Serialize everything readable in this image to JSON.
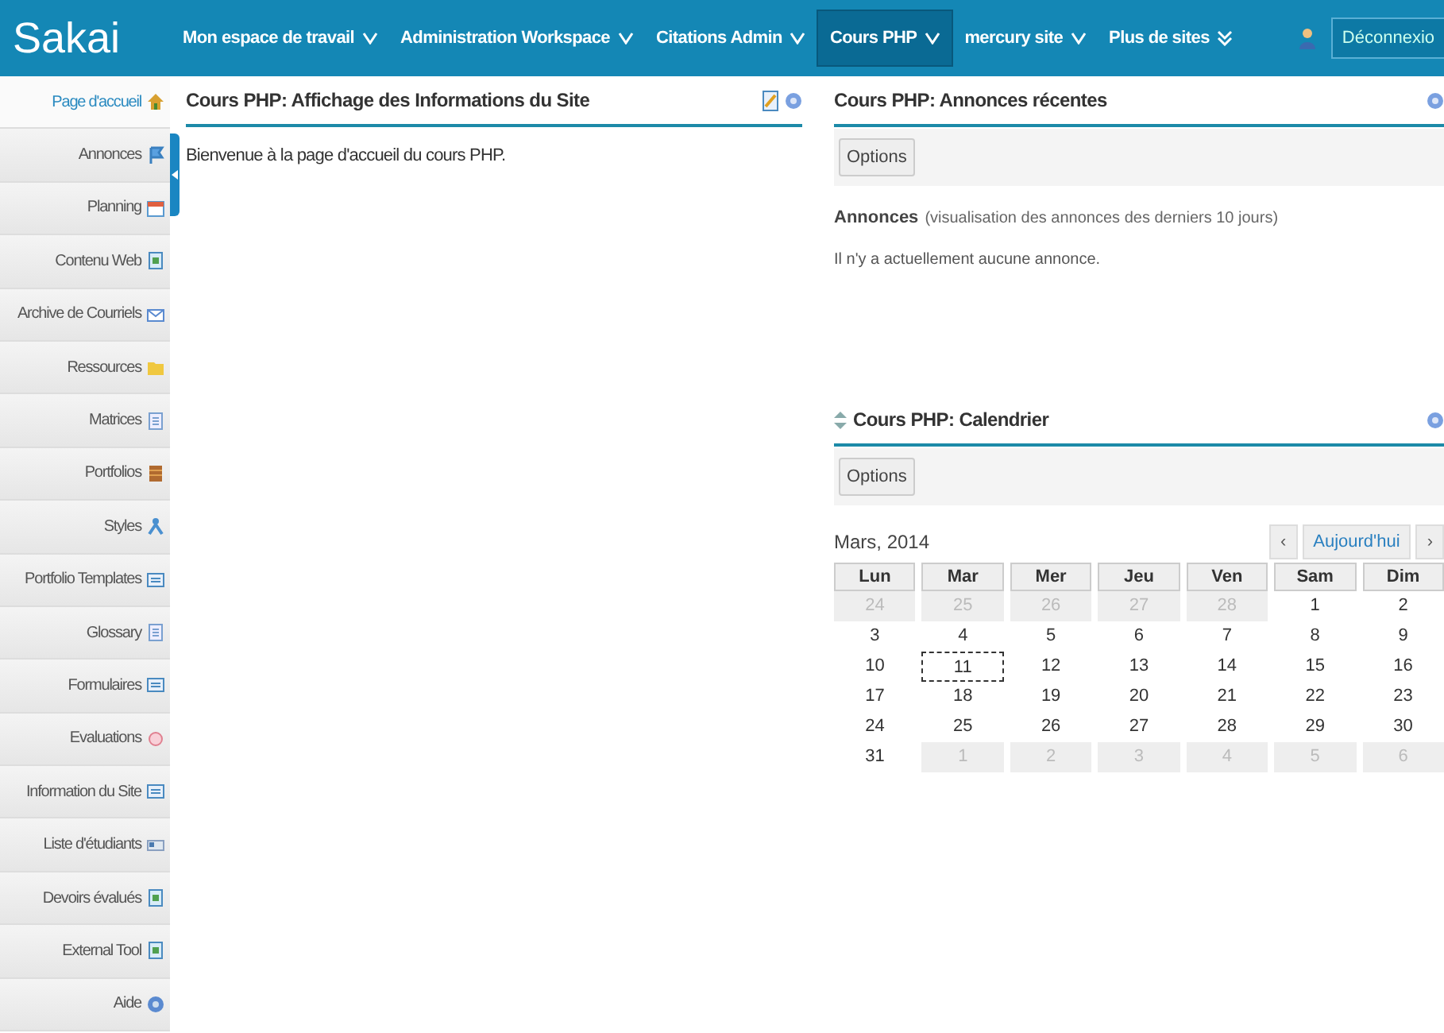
{
  "topbar": {
    "logo": "Sakai",
    "nav": [
      {
        "label": "Mon espace de travail",
        "selected": false,
        "kind": "single"
      },
      {
        "label": "Administration Workspace",
        "selected": false,
        "kind": "single"
      },
      {
        "label": "Citations Admin",
        "selected": false,
        "kind": "single"
      },
      {
        "label": "Cours PHP",
        "selected": true,
        "kind": "single"
      },
      {
        "label": "mercury site",
        "selected": false,
        "kind": "single"
      },
      {
        "label": "Plus de sites",
        "selected": false,
        "kind": "double"
      }
    ],
    "logout": "Déconnexio"
  },
  "sidebar": {
    "items": [
      {
        "label": "Page d'accueil",
        "selected": true
      },
      {
        "label": "Annonces",
        "selected": false
      },
      {
        "label": "Planning",
        "selected": false
      },
      {
        "label": "Contenu Web",
        "selected": false
      },
      {
        "label": "Archive de Courriels",
        "selected": false
      },
      {
        "label": "Ressources",
        "selected": false
      },
      {
        "label": "Matrices",
        "selected": false
      },
      {
        "label": "Portfolios",
        "selected": false
      },
      {
        "label": "Styles",
        "selected": false
      },
      {
        "label": "Portfolio Templates",
        "selected": false
      },
      {
        "label": "Glossary",
        "selected": false
      },
      {
        "label": "Formulaires",
        "selected": false
      },
      {
        "label": "Evaluations",
        "selected": false
      },
      {
        "label": "Information du Site",
        "selected": false
      },
      {
        "label": "Liste d'étudiants",
        "selected": false
      },
      {
        "label": "Devoirs évalués",
        "selected": false
      },
      {
        "label": "External Tool",
        "selected": false
      },
      {
        "label": "Aide",
        "selected": false
      }
    ]
  },
  "info_panel": {
    "title": "Cours PHP: Affichage des Informations du Site",
    "text": "Bienvenue à la page d'accueil du cours PHP."
  },
  "announcements": {
    "title": "Cours PHP: Annonces récentes",
    "options": "Options",
    "heading": "Annonces",
    "subheading": "(visualisation des annonces des derniers 10 jours)",
    "empty": "Il n'y a actuellement aucune annonce."
  },
  "calendar": {
    "title": "Cours PHP: Calendrier",
    "options": "Options",
    "month": "Mars, 2014",
    "prev": "‹",
    "today_button": "Aujourd'hui",
    "next": "›",
    "weekdays": [
      "Lun",
      "Mar",
      "Mer",
      "Jeu",
      "Ven",
      "Sam",
      "Dim"
    ],
    "weeks": [
      [
        {
          "day": "24",
          "other": true,
          "today": false
        },
        {
          "day": "25",
          "other": true,
          "today": false
        },
        {
          "day": "26",
          "other": true,
          "today": false
        },
        {
          "day": "27",
          "other": true,
          "today": false
        },
        {
          "day": "28",
          "other": true,
          "today": false
        },
        {
          "day": "1",
          "other": false,
          "today": false
        },
        {
          "day": "2",
          "other": false,
          "today": false
        }
      ],
      [
        {
          "day": "3",
          "other": false,
          "today": false
        },
        {
          "day": "4",
          "other": false,
          "today": false
        },
        {
          "day": "5",
          "other": false,
          "today": false
        },
        {
          "day": "6",
          "other": false,
          "today": false
        },
        {
          "day": "7",
          "other": false,
          "today": false
        },
        {
          "day": "8",
          "other": false,
          "today": false
        },
        {
          "day": "9",
          "other": false,
          "today": false
        }
      ],
      [
        {
          "day": "10",
          "other": false,
          "today": false
        },
        {
          "day": "11",
          "other": false,
          "today": true
        },
        {
          "day": "12",
          "other": false,
          "today": false
        },
        {
          "day": "13",
          "other": false,
          "today": false
        },
        {
          "day": "14",
          "other": false,
          "today": false
        },
        {
          "day": "15",
          "other": false,
          "today": false
        },
        {
          "day": "16",
          "other": false,
          "today": false
        }
      ],
      [
        {
          "day": "17",
          "other": false,
          "today": false
        },
        {
          "day": "18",
          "other": false,
          "today": false
        },
        {
          "day": "19",
          "other": false,
          "today": false
        },
        {
          "day": "20",
          "other": false,
          "today": false
        },
        {
          "day": "21",
          "other": false,
          "today": false
        },
        {
          "day": "22",
          "other": false,
          "today": false
        },
        {
          "day": "23",
          "other": false,
          "today": false
        }
      ],
      [
        {
          "day": "24",
          "other": false,
          "today": false
        },
        {
          "day": "25",
          "other": false,
          "today": false
        },
        {
          "day": "26",
          "other": false,
          "today": false
        },
        {
          "day": "27",
          "other": false,
          "today": false
        },
        {
          "day": "28",
          "other": false,
          "today": false
        },
        {
          "day": "29",
          "other": false,
          "today": false
        },
        {
          "day": "30",
          "other": false,
          "today": false
        }
      ],
      [
        {
          "day": "31",
          "other": false,
          "today": false
        },
        {
          "day": "1",
          "other": true,
          "today": false
        },
        {
          "day": "2",
          "other": true,
          "today": false
        },
        {
          "day": "3",
          "other": true,
          "today": false
        },
        {
          "day": "4",
          "other": true,
          "today": false
        },
        {
          "day": "5",
          "other": true,
          "today": false
        },
        {
          "day": "6",
          "other": true,
          "today": false
        }
      ]
    ]
  }
}
